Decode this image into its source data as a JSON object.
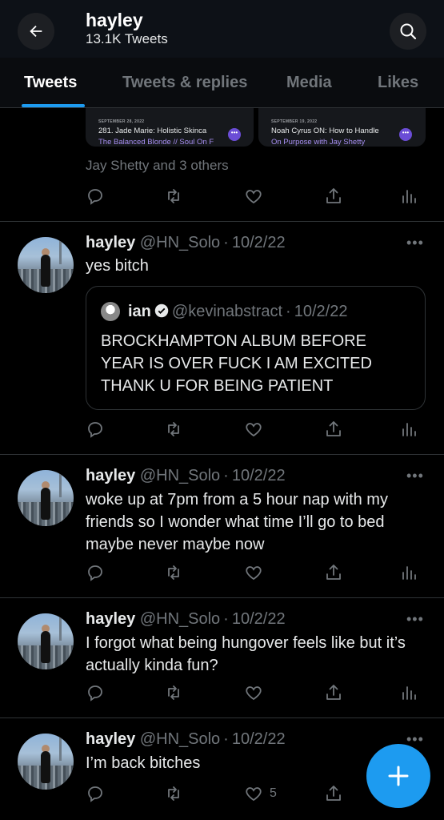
{
  "header": {
    "name": "hayley",
    "tweet_count": "13.1K Tweets"
  },
  "tabs": [
    {
      "label": "Tweets"
    },
    {
      "label": "Tweets & replies"
    },
    {
      "label": "Media"
    },
    {
      "label": "Likes"
    }
  ],
  "cards": [
    {
      "date": "SEPTEMBER 28, 2022",
      "title": "281. Jade Marie: Holistic Skinca",
      "sub": "The Balanced Blonde // Soul On F"
    },
    {
      "date": "SEPTEMBER 19, 2022",
      "title": "Noah Cyrus ON: How to Handle",
      "sub": "On Purpose with Jay Shetty"
    }
  ],
  "liked_by": "Jay Shetty and 3 others",
  "tweets": [
    {
      "name": "hayley",
      "handle": "@HN_Solo",
      "date": "10/2/22",
      "text": "yes bitch",
      "quote": {
        "name": "ian",
        "handle": "@kevinabstract",
        "date": "10/2/22",
        "text": "BROCKHAMPTON ALBUM BEFORE YEAR IS OVER FUCK I AM EXCITED THANK U FOR BEING PATIENT"
      }
    },
    {
      "name": "hayley",
      "handle": "@HN_Solo",
      "date": "10/2/22",
      "text": "woke up at 7pm from a 5 hour nap with my friends so I wonder what time I’ll go to bed maybe never maybe now"
    },
    {
      "name": "hayley",
      "handle": "@HN_Solo",
      "date": "10/2/22",
      "text": "I forgot what being hungover feels like but it’s actually kinda fun?"
    },
    {
      "name": "hayley",
      "handle": "@HN_Solo",
      "date": "10/2/22",
      "text": "I’m back bitches",
      "like_count": "5"
    }
  ],
  "separator": "·",
  "more_dots": "•••",
  "icons": {
    "back": "arrow-left-icon",
    "search": "search-icon",
    "reply": "reply-icon",
    "retweet": "retweet-icon",
    "like": "heart-icon",
    "share": "share-icon",
    "views": "views-icon",
    "compose": "plus-icon"
  },
  "colors": {
    "accent": "#1d9bf0",
    "background": "#000000",
    "muted": "#71767b"
  }
}
